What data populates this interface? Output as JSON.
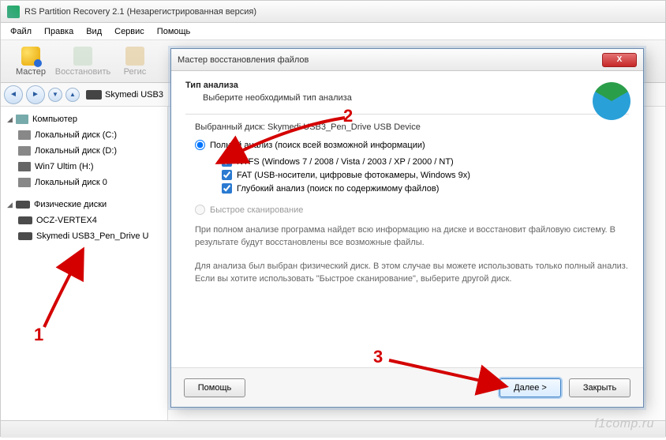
{
  "window": {
    "title": "RS Partition Recovery 2.1 (Незарегистрированная версия)"
  },
  "menu": {
    "file": "Файл",
    "edit": "Правка",
    "view": "Вид",
    "service": "Сервис",
    "help": "Помощь"
  },
  "toolbar": {
    "master": "Мастер",
    "restore": "Восстановить",
    "registry": "Регис"
  },
  "breadcrumb": {
    "drive": "Skymedi USB3"
  },
  "tree": {
    "computer": "Компьютер",
    "local_c": "Локальный диск (C:)",
    "local_d": "Локальный диск (D:)",
    "win7": "Win7 Ultim (H:)",
    "local_0": "Локальный диск 0",
    "physical": "Физические диски",
    "ocz": "OCZ-VERTEX4",
    "skymedi": "Skymedi USB3_Pen_Drive U"
  },
  "wizard": {
    "title": "Мастер восстановления файлов",
    "heading": "Тип анализа",
    "subheading": "Выберите необходимый тип анализа",
    "selected_disk_label": "Выбранный диск:",
    "selected_disk_value": "Skymedi USB3_Pen_Drive USB Device",
    "full_scan": "Полный анализ (поиск всей возможной информации)",
    "ntfs": "NTFS (Windows 7 / 2008 / Vista / 2003 / XP / 2000 / NT)",
    "fat": "FAT (USB-носители, цифровые фотокамеры, Windows 9x)",
    "deep": "Глубокий анализ (поиск по содержимому файлов)",
    "quick_scan": "Быстрое сканирование",
    "info1": "При полном анализе программа найдет всю информацию на диске и восстановит файловую систему. В результате будут восстановлены все возможные файлы.",
    "info2": "Для анализа был выбран физический диск. В этом случае вы можете использовать только полный анализ. Если вы хотите использовать \"Быстрое сканирование\", выберите другой диск.",
    "help_btn": "Помощь",
    "next_btn": "Далее >",
    "close_btn": "Закрыть"
  },
  "annotations": {
    "n1": "1",
    "n2": "2",
    "n3": "3"
  },
  "watermark": "f1comp.ru"
}
